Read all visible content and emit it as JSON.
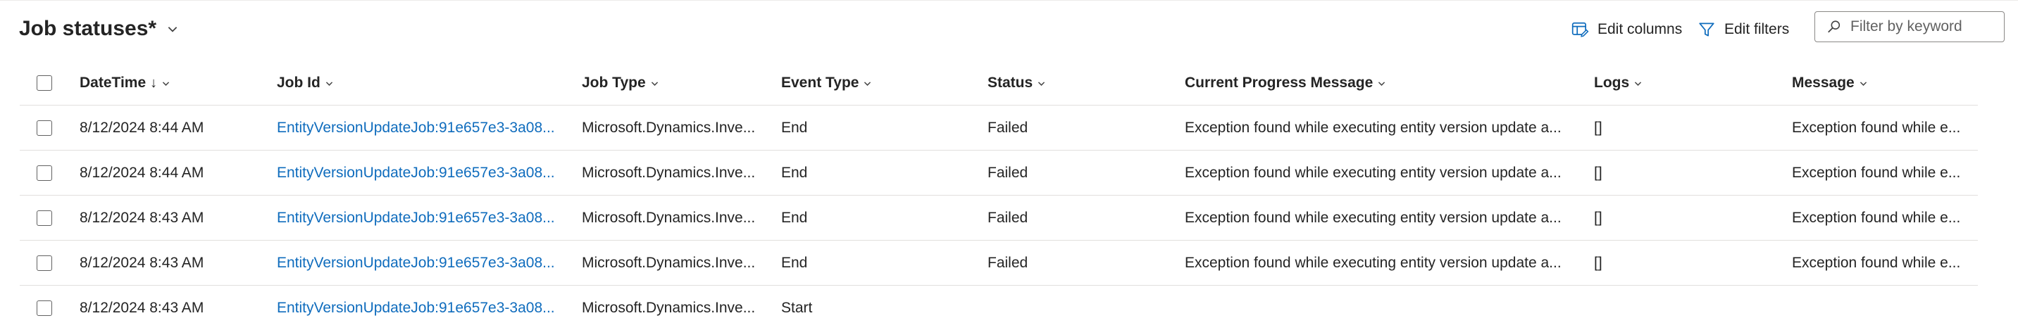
{
  "header": {
    "title": "Job statuses*",
    "edit_columns": "Edit columns",
    "edit_filters": "Edit filters",
    "filter_placeholder": "Filter by keyword"
  },
  "columns": [
    "DateTime",
    "Job Id",
    "Job Type",
    "Event Type",
    "Status",
    "Current Progress Message",
    "Logs",
    "Message"
  ],
  "sort_indicator": "↓",
  "rows": [
    {
      "datetime": "8/12/2024 8:44 AM",
      "job_id": "EntityVersionUpdateJob:91e657e3-3a08...",
      "job_type": "Microsoft.Dynamics.Inve...",
      "event_type": "End",
      "status": "Failed",
      "progress": "Exception found while executing entity version update a...",
      "logs": "[]",
      "message": "Exception found while e..."
    },
    {
      "datetime": "8/12/2024 8:44 AM",
      "job_id": "EntityVersionUpdateJob:91e657e3-3a08...",
      "job_type": "Microsoft.Dynamics.Inve...",
      "event_type": "End",
      "status": "Failed",
      "progress": "Exception found while executing entity version update a...",
      "logs": "[]",
      "message": "Exception found while e..."
    },
    {
      "datetime": "8/12/2024 8:43 AM",
      "job_id": "EntityVersionUpdateJob:91e657e3-3a08...",
      "job_type": "Microsoft.Dynamics.Inve...",
      "event_type": "End",
      "status": "Failed",
      "progress": "Exception found while executing entity version update a...",
      "logs": "[]",
      "message": "Exception found while e..."
    },
    {
      "datetime": "8/12/2024 8:43 AM",
      "job_id": "EntityVersionUpdateJob:91e657e3-3a08...",
      "job_type": "Microsoft.Dynamics.Inve...",
      "event_type": "End",
      "status": "Failed",
      "progress": "Exception found while executing entity version update a...",
      "logs": "[]",
      "message": "Exception found while e..."
    },
    {
      "datetime": "8/12/2024 8:43 AM",
      "job_id": "EntityVersionUpdateJob:91e657e3-3a08...",
      "job_type": "Microsoft.Dynamics.Inve...",
      "event_type": "Start",
      "status": "",
      "progress": "",
      "logs": "",
      "message": ""
    }
  ],
  "colors": {
    "link": "#0f6cbd",
    "accent_icon": "#0f6cbd",
    "text": "#242424",
    "divider": "#e1dfdd"
  }
}
